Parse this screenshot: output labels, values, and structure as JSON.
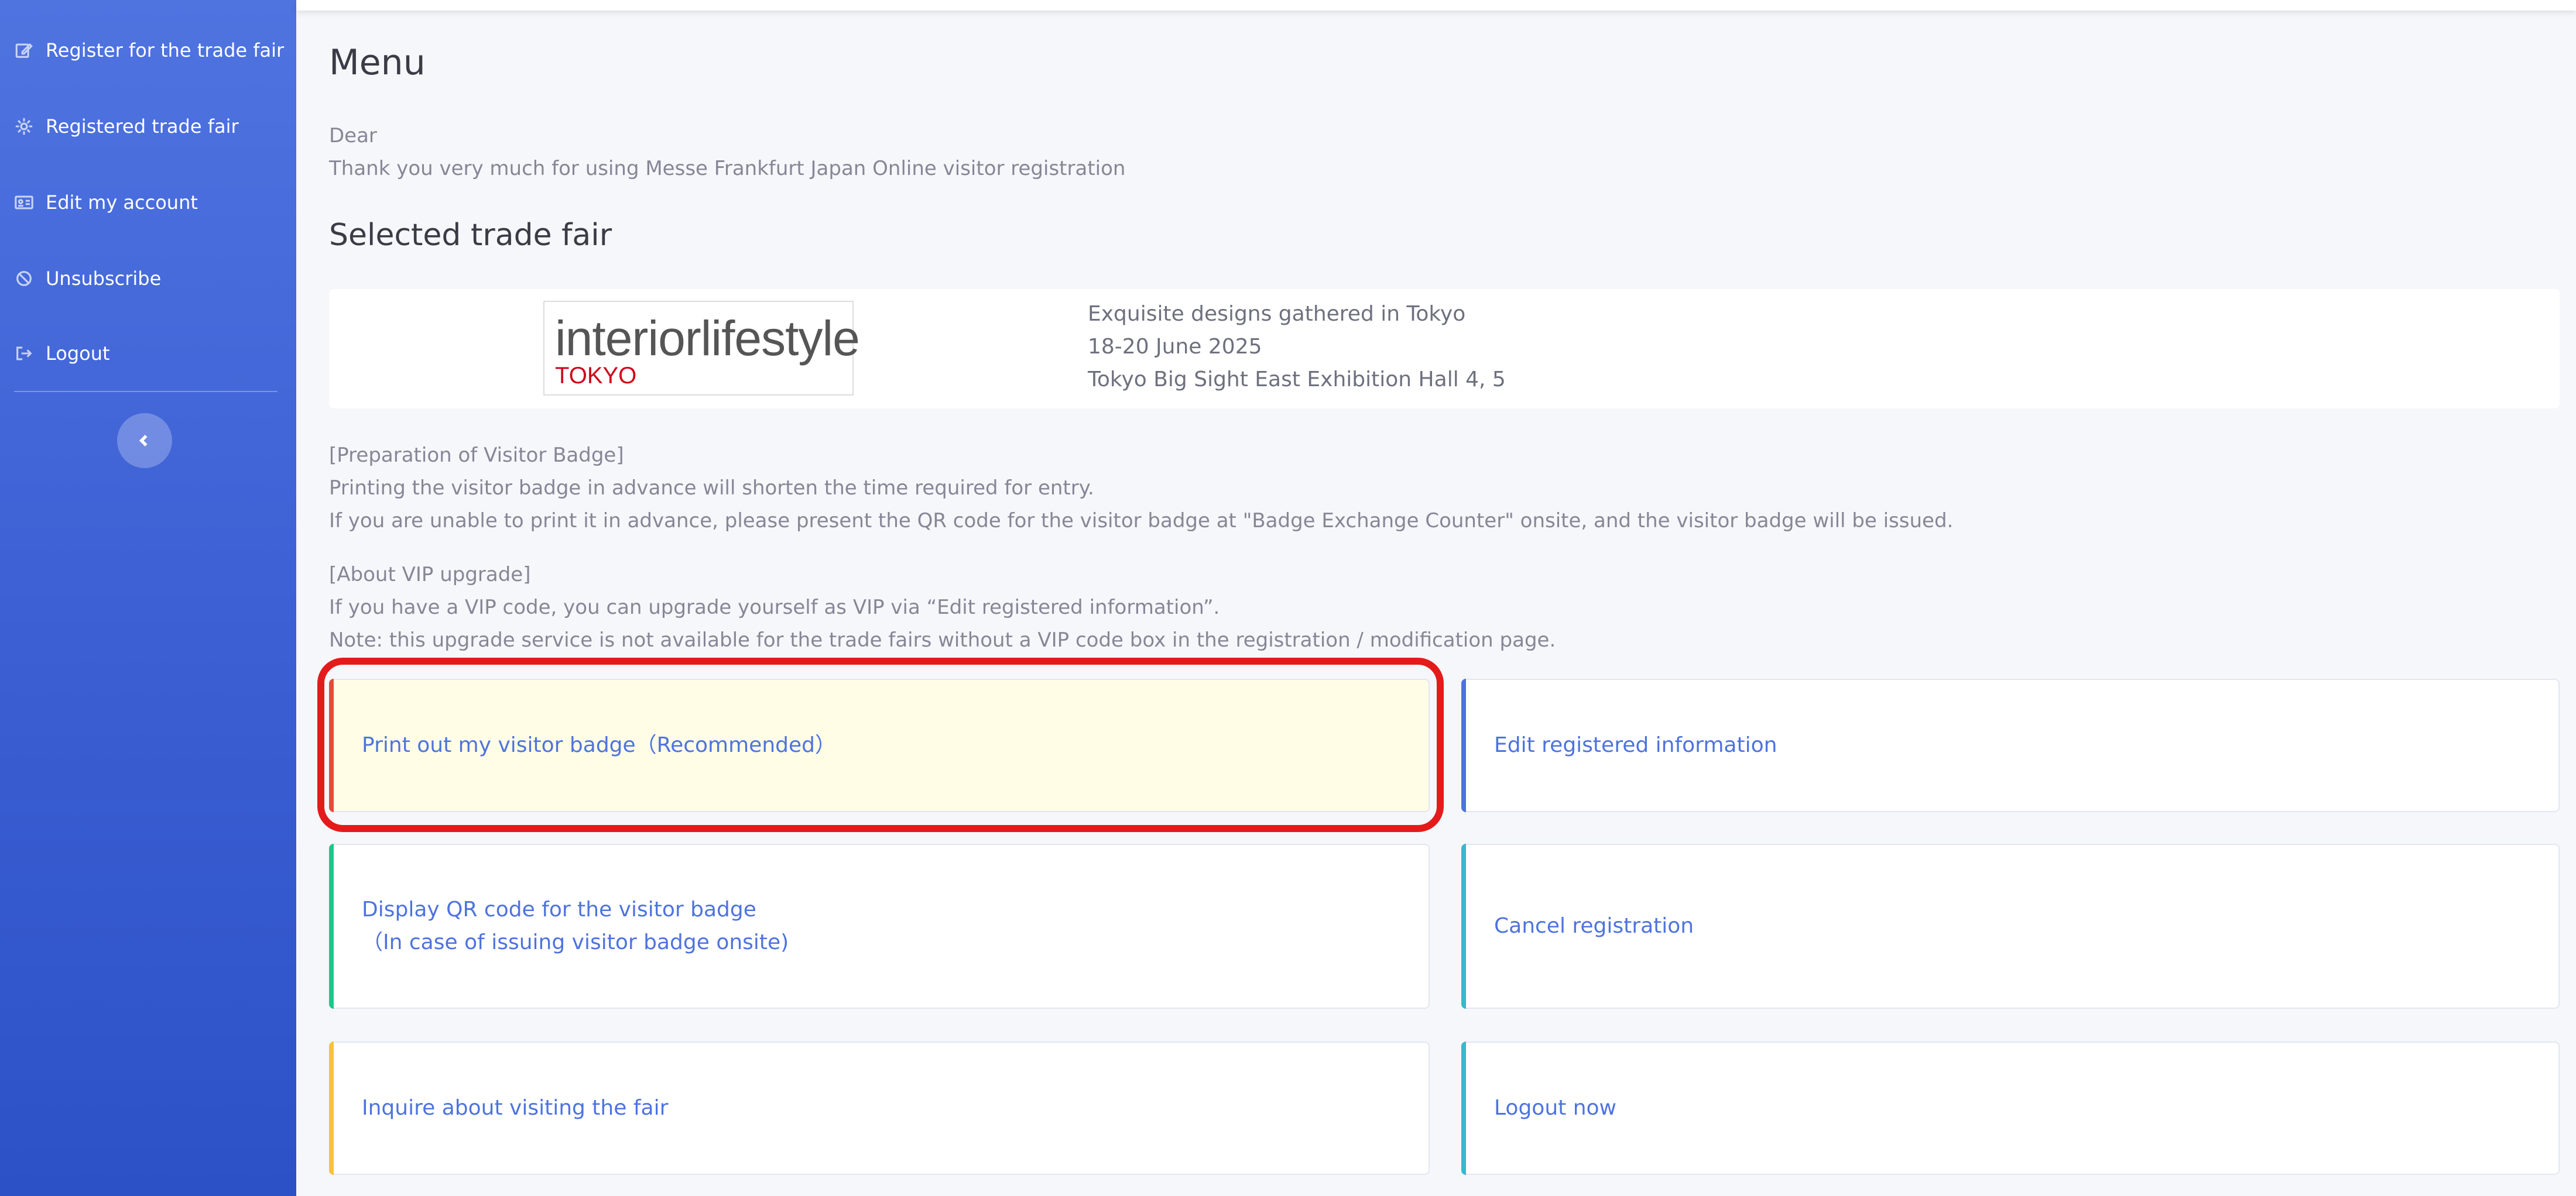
{
  "sidebar": {
    "items": [
      {
        "label": "Register for the trade fair",
        "icon": "edit-icon"
      },
      {
        "label": "Registered trade fair",
        "icon": "gear-icon"
      },
      {
        "label": "Edit my account",
        "icon": "id-card-icon"
      },
      {
        "label": "Unsubscribe",
        "icon": "ban-icon"
      },
      {
        "label": "Logout",
        "icon": "sign-out-icon"
      }
    ],
    "toggle_icon": "chevron-left-icon"
  },
  "main": {
    "title": "Menu",
    "greeting": "Dear",
    "thanks": "Thank you very much for using Messe Frankfurt Japan Online visitor registration",
    "selected_heading": "Selected trade fair",
    "fair": {
      "logo_main": "interiorlifestyle",
      "logo_sub": "TOKYO",
      "tagline": "Exquisite designs gathered in Tokyo",
      "dates": "18-20 June 2025",
      "venue": "Tokyo Big Sight East Exhibition Hall 4, 5"
    },
    "badge_info": {
      "heading": "[Preparation of Visitor Badge]",
      "line1": "Printing the visitor badge in advance will shorten the time required for entry.",
      "line2": "If you are unable to print it in advance, please present the QR code for the visitor badge at \"Badge Exchange Counter\" onsite, and the visitor badge will be issued."
    },
    "vip_info": {
      "heading": "[About VIP upgrade]",
      "line1": "If you have a VIP code, you can upgrade yourself as VIP via “Edit registered information”.",
      "line2": "Note: this upgrade service is not available for the trade fairs without a VIP code box in the registration / modification page."
    },
    "actions": {
      "print_badge": "Print out my visitor badge（Recommended）",
      "edit_info": "Edit registered information",
      "display_qr_line1": "Display QR code for the visitor badge",
      "display_qr_line2": "（In case of issuing visitor badge onsite)",
      "cancel": "Cancel registration",
      "inquire": "Inquire about visiting the fair",
      "logout": "Logout now"
    }
  },
  "colors": {
    "sidebar": "#4e73df",
    "highlight": "#e41b1b",
    "print_bar": "#e74a3b",
    "edit_bar": "#4e73df",
    "qr_bar": "#1cc88a",
    "cancel_bar": "#36b9cc",
    "inquire_bar": "#f6c23e",
    "logout_bar": "#36b9cc",
    "print_bg": "#fffde6"
  }
}
